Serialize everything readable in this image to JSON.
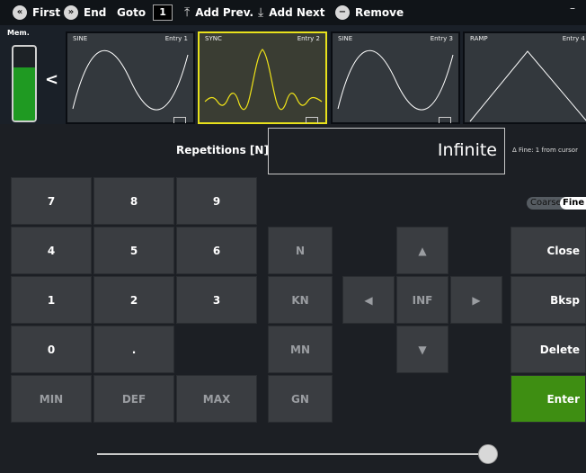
{
  "toolbar": {
    "first": "First",
    "end": "End",
    "goto": "Goto",
    "goto_value": "1",
    "add_prev": "Add Prev.",
    "add_next": "Add Next",
    "remove": "Remove",
    "window_minimize": "–"
  },
  "memory": {
    "label": "Mem.",
    "fill_fraction": 0.72,
    "fill_color": "#1f9a22"
  },
  "entries": [
    {
      "type": "SINE",
      "label": "Entry 1",
      "selected": false
    },
    {
      "type": "SYNC",
      "label": "Entry 2",
      "selected": true
    },
    {
      "type": "SINE",
      "label": "Entry 3",
      "selected": false
    },
    {
      "type": "RAMP",
      "label": "Entry 4",
      "selected": false
    }
  ],
  "editor": {
    "param_label": "Repetitions [N]",
    "value": "Infinite",
    "fine_info": "Δ Fine: 1 from cursor",
    "coarse_label": "Coarse",
    "fine_label": "Fine"
  },
  "keypad": {
    "k7": "7",
    "k8": "8",
    "k9": "9",
    "k4": "4",
    "k5": "5",
    "k6": "6",
    "k1": "1",
    "k2": "2",
    "k3": "3",
    "k0": "0",
    "kdot": ".",
    "min": "MIN",
    "def": "DEF",
    "max": "MAX"
  },
  "units": {
    "n": "N",
    "kn": "KN",
    "mn": "MN",
    "gn": "GN"
  },
  "nav": {
    "up": "▲",
    "down": "▼",
    "left": "◀",
    "right": "▶",
    "inf": "INF"
  },
  "actions": {
    "close": "Close",
    "bksp": "Bksp",
    "delete": "Delete",
    "enter": "Enter"
  },
  "slider": {
    "position_fraction": 0.98
  },
  "colors": {
    "selected_border": "#e8e11c",
    "sync_wave": "#f0e418",
    "enter": "#3e8e12",
    "wave": "#ffffff"
  }
}
